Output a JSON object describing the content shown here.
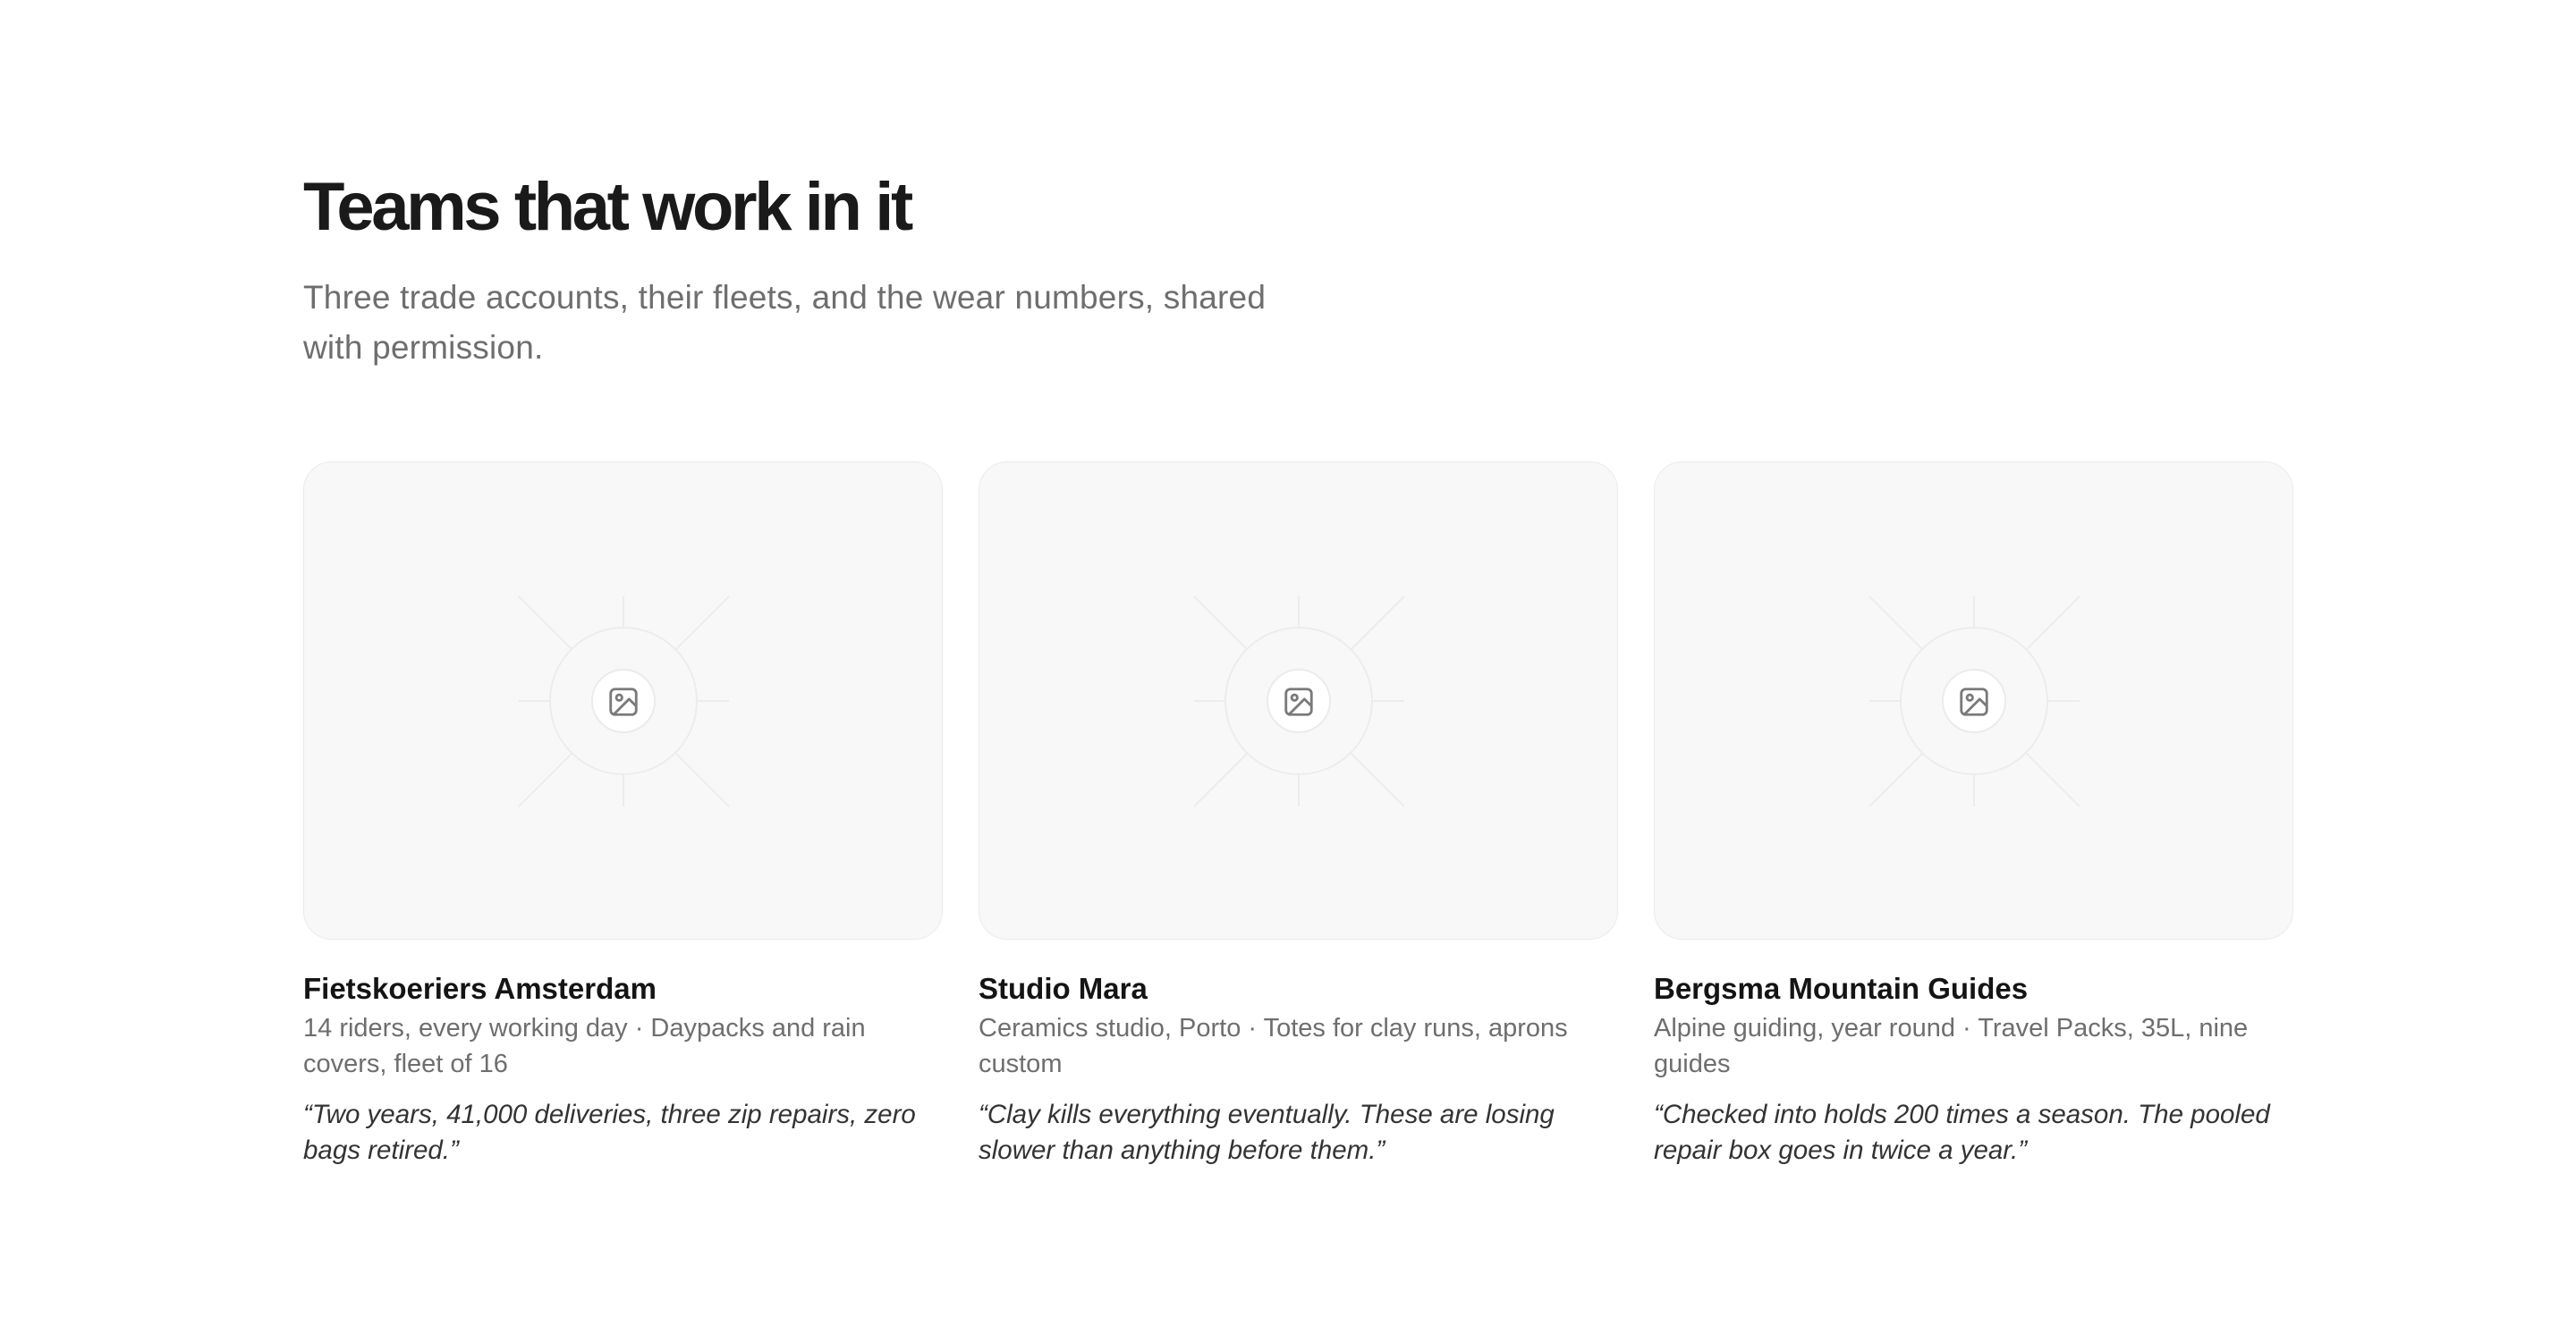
{
  "section": {
    "title": "Teams that work in it",
    "subtitle": "Three trade accounts, their fleets, and the wear numbers, shared with permission."
  },
  "teams": [
    {
      "name": "Fietskoeriers Amsterdam",
      "meta": "14 riders, every working day · Daypacks and rain covers, fleet of 16",
      "quote": "“Two years, 41,000 deliveries, three zip repairs, zero bags retired.”",
      "image_icon": "image-placeholder-icon"
    },
    {
      "name": "Studio Mara",
      "meta": "Ceramics studio, Porto · Totes for clay runs, aprons custom",
      "quote": "“Clay kills everything eventually. These are losing slower than anything before them.”",
      "image_icon": "image-placeholder-icon"
    },
    {
      "name": "Bergsma Mountain Guides",
      "meta": "Alpine guiding, year round · Travel Packs, 35L, nine guides",
      "quote": "“Checked into holds 200 times a season. The pooled repair box goes in twice a year.”",
      "image_icon": "image-placeholder-icon"
    }
  ],
  "colors": {
    "heading": "#1a1a1a",
    "muted": "#6e6e6e",
    "quote": "#333333",
    "placeholder_bg": "#f8f8f8",
    "placeholder_border": "#ebebeb"
  }
}
